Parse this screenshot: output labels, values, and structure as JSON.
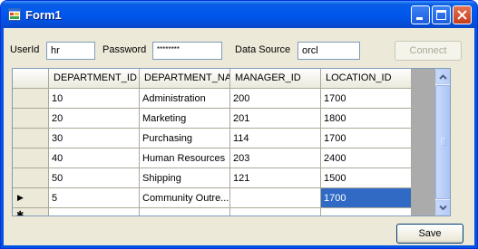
{
  "window": {
    "title": "Form1"
  },
  "login": {
    "userid_label": "UserId",
    "userid_value": "hr",
    "password_label": "Password",
    "password_value": "********",
    "datasource_label": "Data Source",
    "datasource_value": "orcl",
    "connect_label": "Connect"
  },
  "grid": {
    "columns": [
      "DEPARTMENT_ID",
      "DEPARTMENT_NAME",
      "MANAGER_ID",
      "LOCATION_ID"
    ],
    "rows": [
      [
        "10",
        "Administration",
        "200",
        "1700"
      ],
      [
        "20",
        "Marketing",
        "201",
        "1800"
      ],
      [
        "30",
        "Purchasing",
        "114",
        "1700"
      ],
      [
        "40",
        "Human Resources",
        "203",
        "2400"
      ],
      [
        "50",
        "Shipping",
        "121",
        "1500"
      ],
      [
        "5",
        "Community Outre...",
        "",
        "1700"
      ]
    ],
    "current_row_marker": "▶",
    "new_row_marker": "✱"
  },
  "footer": {
    "save_label": "Save"
  },
  "colors": {
    "titlebar": "#0058ee",
    "selection": "#316ac5",
    "face": "#ece9d8"
  },
  "icons": {
    "app": "form-app-icon",
    "min": "minimize-icon",
    "max": "maximize-icon",
    "close": "close-icon"
  }
}
